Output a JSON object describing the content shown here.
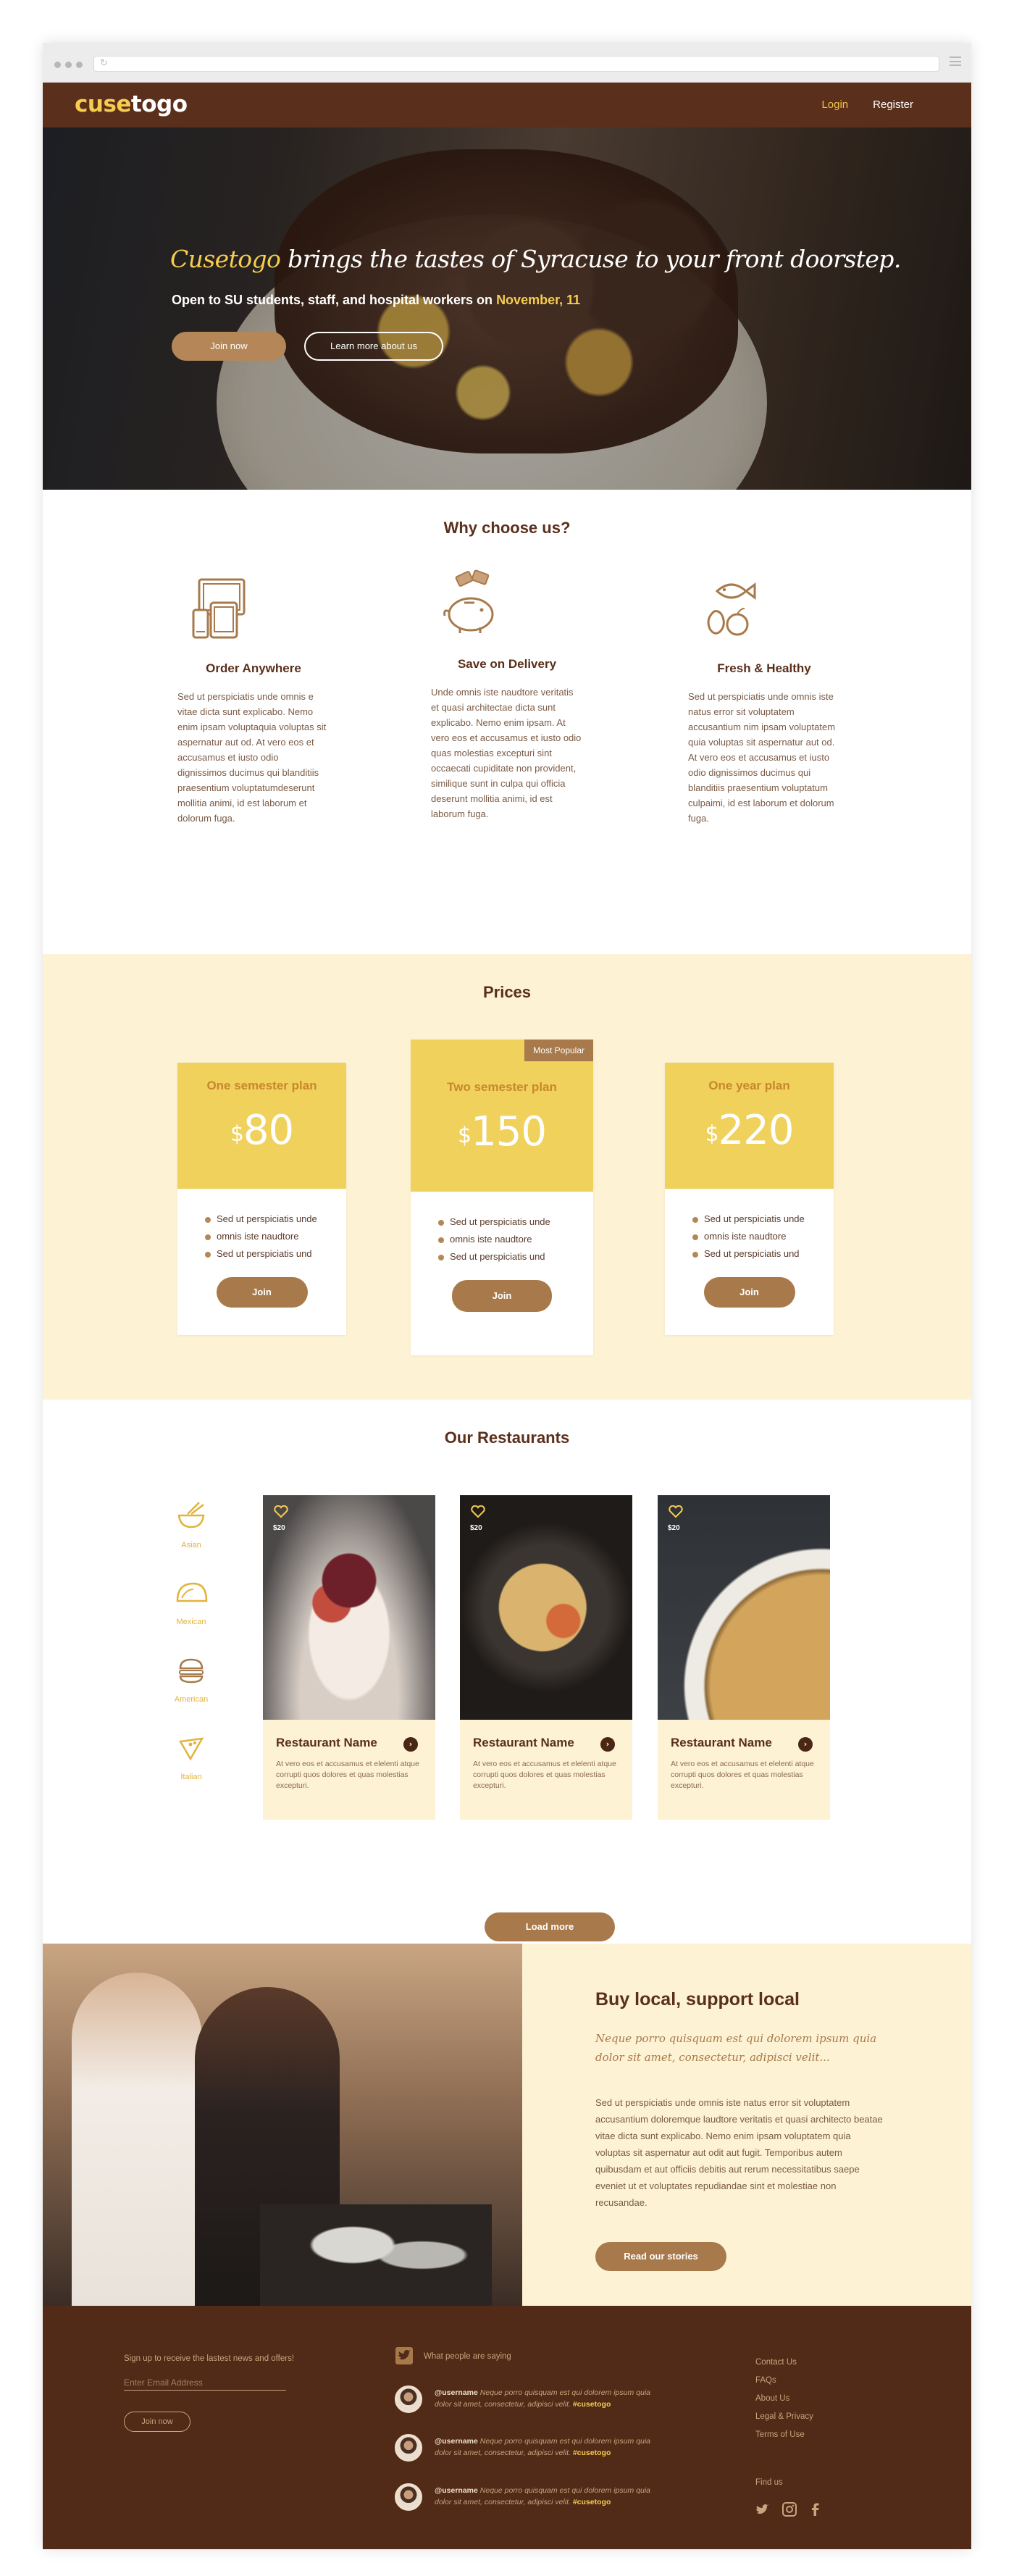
{
  "brand": {
    "prefix": "cuse",
    "suffix": "togo"
  },
  "nav": {
    "login": "Login",
    "register": "Register"
  },
  "hero": {
    "brand_word": "Cusetogo",
    "headline_rest": " brings the tastes of Syracuse to your front doorstep.",
    "sub_text": "Open to SU students, staff, and hospital workers on ",
    "sub_date": "November, 11",
    "join_label": "Join now",
    "learn_label": "Learn more about us"
  },
  "why": {
    "title": "Why choose us?",
    "features": [
      {
        "title": "Order Anywhere",
        "icon": "devices-icon",
        "text": "Sed ut perspiciatis unde omnis e vitae dicta sunt explicabo. Nemo enim ipsam voluptaquia voluptas sit aspernatur aut od. At vero eos et accusamus et iusto odio dignissimos ducimus qui blanditiis praesentium voluptatumdeserunt mollitia animi, id est laborum et dolorum fuga."
      },
      {
        "title": "Save on Delivery",
        "icon": "piggy-bank-icon",
        "text": "Unde omnis iste naudtore veritatis et quasi architectae dicta sunt explicabo. Nemo enim ipsam. At vero eos et accusamus et iusto odio quas molestias excepturi sint occaecati cupiditate non provident, similique sunt in culpa qui officia deserunt mollitia animi, id est laborum fuga."
      },
      {
        "title": "Fresh & Healthy",
        "icon": "fish-fruit-icon",
        "text": "Sed ut perspiciatis unde omnis iste natus error sit voluptatem accusantium nim ipsam voluptatem quia voluptas sit aspernatur aut od. At vero eos et accusamus et iusto odio dignissimos ducimus qui blanditiis praesentium voluptatum culpaimi, id est laborum et dolorum fuga."
      }
    ]
  },
  "prices": {
    "title": "Prices",
    "badge": "Most Popular",
    "plans": [
      {
        "name": "One semester plan",
        "currency": "$",
        "amount": "80",
        "items": [
          "Sed ut perspiciatis unde",
          "omnis iste naudtore",
          "Sed ut perspiciatis und"
        ],
        "button": "Join"
      },
      {
        "name": "Two semester plan",
        "currency": "$",
        "amount": "150",
        "items": [
          "Sed ut perspiciatis unde",
          "omnis iste naudtore",
          "Sed ut perspiciatis und"
        ],
        "button": "Join"
      },
      {
        "name": "One year plan",
        "currency": "$",
        "amount": "220",
        "items": [
          "Sed ut perspiciatis unde",
          "omnis iste naudtore",
          "Sed ut perspiciatis und"
        ],
        "button": "Join"
      }
    ]
  },
  "restaurants": {
    "title": "Our Restaurants",
    "categories": [
      {
        "label": "Asian",
        "icon": "noodle-bowl-icon"
      },
      {
        "label": "Mexican",
        "icon": "taco-icon"
      },
      {
        "label": "American",
        "icon": "burger-icon"
      },
      {
        "label": "Italian",
        "icon": "pizza-slice-icon"
      }
    ],
    "cards": [
      {
        "price": "$20",
        "name": "Restaurant Name",
        "desc": "At vero eos et accusamus et elelenti atque corrupti quos dolores et quas molestias excepturi."
      },
      {
        "price": "$20",
        "name": "Restaurant Name",
        "desc": "At vero eos et accusamus et elelenti atque corrupti quos dolores et quas molestias excepturi."
      },
      {
        "price": "$20",
        "name": "Restaurant Name",
        "desc": "At vero eos et accusamus et elelenti atque corrupti quos dolores et quas molestias excepturi."
      }
    ],
    "load_more": "Load more"
  },
  "local": {
    "title": "Buy local, support local",
    "lead": "Neque porro quisquam est qui dolorem ipsum quia dolor sit amet, consectetur, adipisci velit...",
    "body": "Sed ut perspiciatis unde omnis iste natus error sit voluptatem accusantium doloremque laudtore veritatis et quasi architecto beatae vitae dicta sunt explicabo. Nemo enim ipsam voluptatem quia voluptas sit aspernatur aut odit aut fugit. Temporibus autem quibusdam et aut officiis debitis aut rerum necessitatibus saepe eveniet ut et voluptates repudiandae sint et molestiae non recusandae.",
    "button": "Read our stories"
  },
  "footer": {
    "signup_text": "Sign up to receive the lastest news and offers!",
    "email_placeholder": "Enter Email Address",
    "join_label": "Join now",
    "tweets_heading": "What people are saying",
    "tweets": [
      {
        "user": "@username",
        "text": " Neque porro quisquam est qui dolorem ipsum quia dolor sit amet, consectetur, adipisci velit. ",
        "tag": "#cusetogo"
      },
      {
        "user": "@username",
        "text": " Neque porro quisquam est qui dolorem ipsum quia dolor sit amet, consectetur, adipisci velit. ",
        "tag": "#cusetogo"
      },
      {
        "user": "@username",
        "text": " Neque porro quisquam est qui dolorem ipsum quia dolor sit amet, consectetur, adipisci velit. ",
        "tag": "#cusetogo"
      }
    ],
    "links": [
      "Contact Us",
      "FAQs",
      "About Us",
      "Legal & Privacy",
      "Terms of Use"
    ],
    "find_us": "Find us"
  }
}
